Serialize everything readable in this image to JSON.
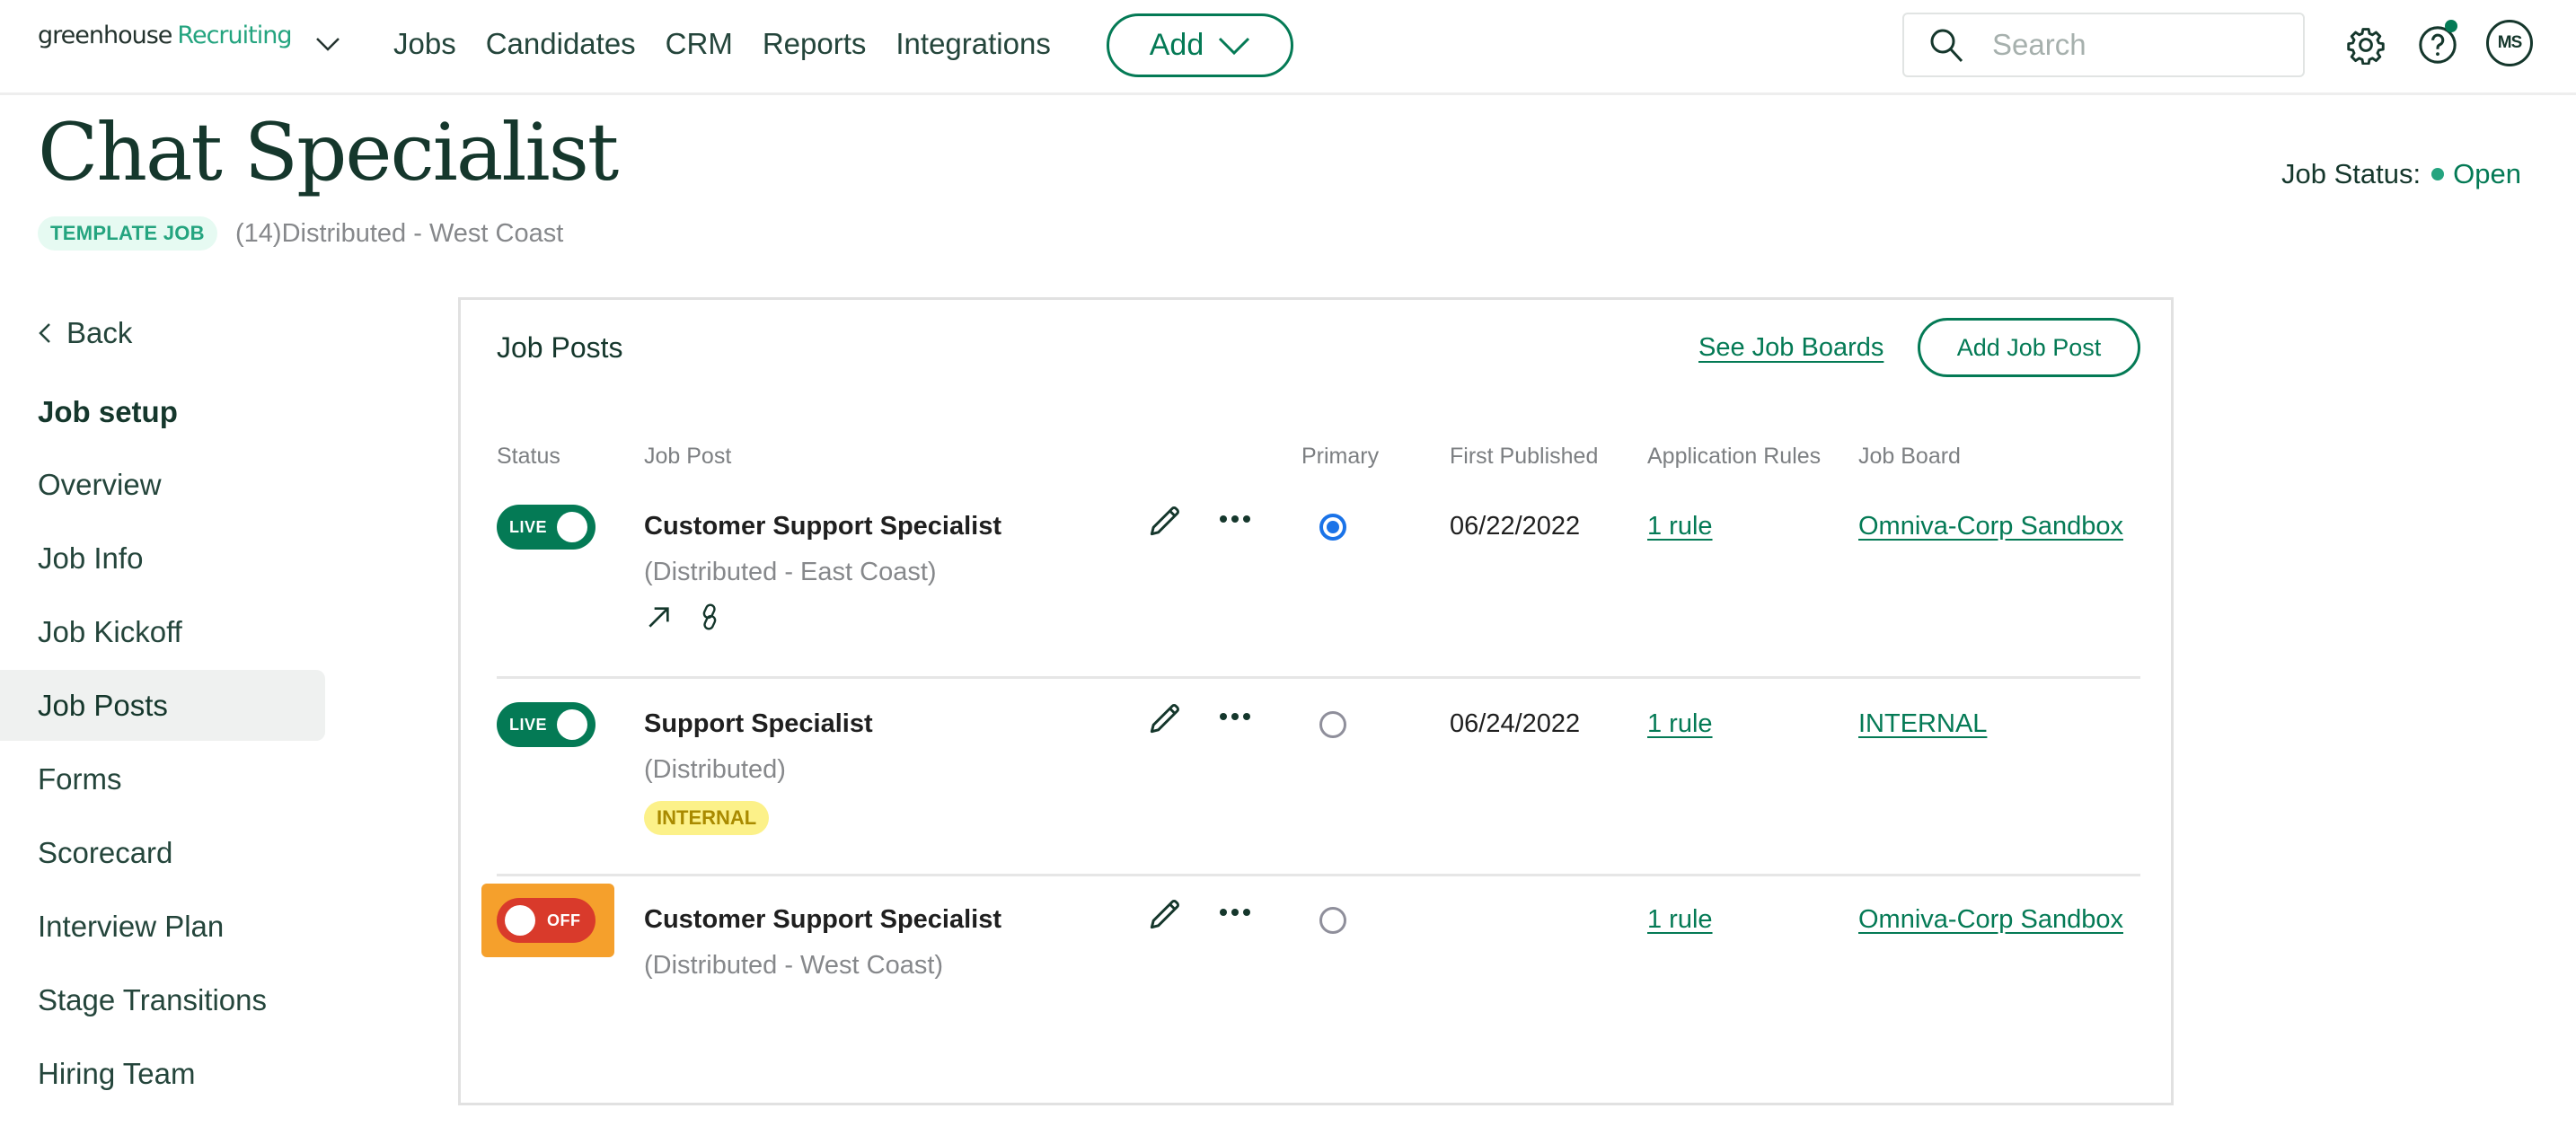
{
  "nav": {
    "logo_primary": "greenhouse",
    "logo_secondary": "Recruiting",
    "links": [
      "Jobs",
      "Candidates",
      "CRM",
      "Reports",
      "Integrations"
    ],
    "add_label": "Add",
    "search_placeholder": "Search",
    "avatar_initials": "MS",
    "icons": [
      "chevron-down-icon",
      "search-icon",
      "gear-icon",
      "help-icon",
      "notification-dot"
    ]
  },
  "header": {
    "title": "Chat Specialist",
    "badge": "TEMPLATE JOB",
    "location": "(14)Distributed - West Coast",
    "status_label": "Job Status:",
    "status_value": "Open"
  },
  "sidebar": {
    "back_label": "Back",
    "heading": "Job setup",
    "items": [
      {
        "label": "Overview",
        "active": false
      },
      {
        "label": "Job Info",
        "active": false
      },
      {
        "label": "Job Kickoff",
        "active": false
      },
      {
        "label": "Job Posts",
        "active": true
      },
      {
        "label": "Forms",
        "active": false
      },
      {
        "label": "Scorecard",
        "active": false
      },
      {
        "label": "Interview Plan",
        "active": false
      },
      {
        "label": "Stage Transitions",
        "active": false
      },
      {
        "label": "Hiring Team",
        "active": false
      }
    ]
  },
  "card": {
    "title": "Job Posts",
    "see_boards_label": "See Job Boards",
    "add_post_label": "Add Job Post",
    "columns": [
      "Status",
      "Job Post",
      "Primary",
      "First Published",
      "Application Rules",
      "Job Board"
    ],
    "rows": [
      {
        "status": "LIVE",
        "name": "Customer Support Specialist",
        "location": "(Distributed - East Coast)",
        "tag": "",
        "primary": true,
        "first_published": "06/22/2022",
        "rules": "1 rule",
        "board": "Omniva-Corp Sandbox",
        "extra_icons": [
          "external-link-icon",
          "link-icon"
        ]
      },
      {
        "status": "LIVE",
        "name": "Support Specialist",
        "location": "(Distributed)",
        "tag": "INTERNAL",
        "primary": false,
        "first_published": "06/24/2022",
        "rules": "1 rule",
        "board": "INTERNAL"
      },
      {
        "status": "OFF",
        "name": "Customer Support Specialist",
        "location": "(Distributed - West Coast)",
        "tag": "",
        "primary": false,
        "first_published": "",
        "rules": "1 rule",
        "board": "Omniva-Corp Sandbox",
        "highlighted": true
      }
    ]
  },
  "colors": {
    "brand_green": "#047a55",
    "accent_green": "#24a47f",
    "off_red": "#d93a2b",
    "highlight_orange": "#f5a02c",
    "primary_blue": "#1a73e8",
    "internal_yellow": "#fcf189"
  }
}
